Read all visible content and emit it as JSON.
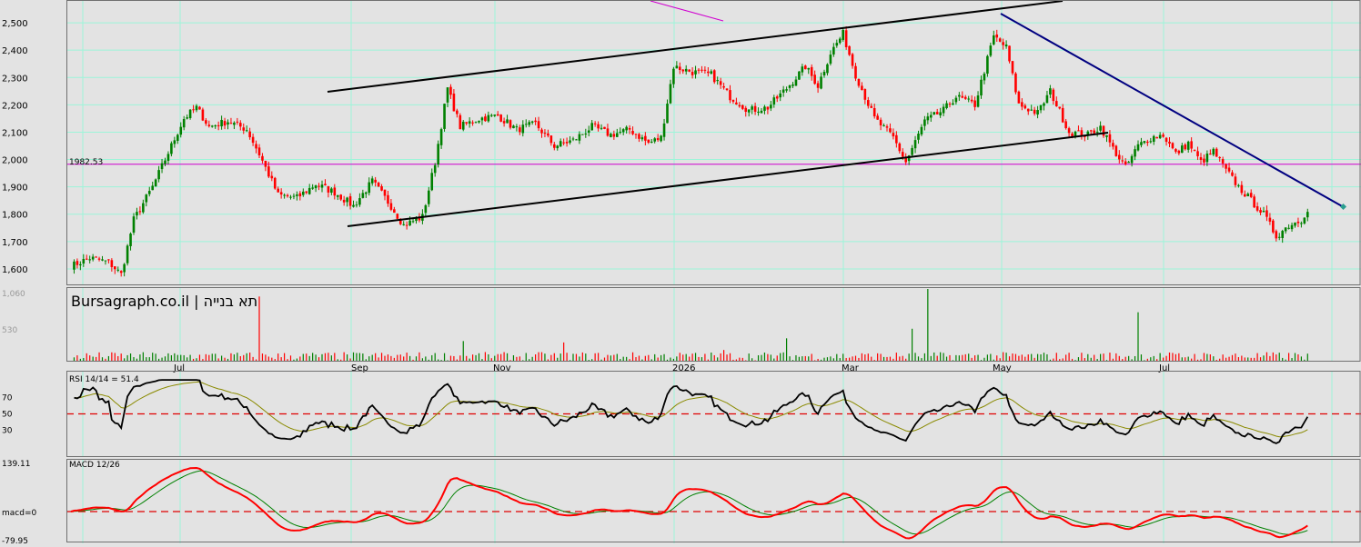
{
  "chart_data": {
    "type": "candlestick",
    "title": "Bursagraph.co.il | תא בנייה",
    "price_axis": {
      "ticks": [
        "2,500",
        "2,400",
        "2,300",
        "2,200",
        "2,100",
        "2,000",
        "1,900",
        "1,800",
        "1,700",
        "1,600"
      ],
      "ylim": [
        1540,
        2570
      ],
      "reference_label": "1982.53",
      "reference_value": 1982.53
    },
    "time_axis": {
      "labels": [
        "Jul",
        "Sep",
        "Nov",
        "2026",
        "Mar",
        "May",
        "Jul"
      ]
    },
    "price_anchors": [
      [
        0,
        1610
      ],
      [
        6,
        1640
      ],
      [
        12,
        1625
      ],
      [
        16,
        1580
      ],
      [
        20,
        1780
      ],
      [
        26,
        1900
      ],
      [
        30,
        2000
      ],
      [
        36,
        2150
      ],
      [
        40,
        2190
      ],
      [
        44,
        2120
      ],
      [
        50,
        2140
      ],
      [
        56,
        2110
      ],
      [
        60,
        2020
      ],
      [
        66,
        1870
      ],
      [
        72,
        1860
      ],
      [
        78,
        1910
      ],
      [
        84,
        1880
      ],
      [
        90,
        1830
      ],
      [
        96,
        1920
      ],
      [
        102,
        1830
      ],
      [
        106,
        1760
      ],
      [
        112,
        1790
      ],
      [
        116,
        1990
      ],
      [
        120,
        2260
      ],
      [
        124,
        2120
      ],
      [
        130,
        2150
      ],
      [
        136,
        2160
      ],
      [
        142,
        2110
      ],
      [
        148,
        2130
      ],
      [
        154,
        2050
      ],
      [
        160,
        2070
      ],
      [
        166,
        2120
      ],
      [
        172,
        2090
      ],
      [
        178,
        2110
      ],
      [
        184,
        2060
      ],
      [
        188,
        2080
      ],
      [
        192,
        2340
      ],
      [
        198,
        2320
      ],
      [
        204,
        2310
      ],
      [
        210,
        2230
      ],
      [
        216,
        2180
      ],
      [
        222,
        2190
      ],
      [
        228,
        2260
      ],
      [
        234,
        2340
      ],
      [
        238,
        2270
      ],
      [
        242,
        2390
      ],
      [
        246,
        2460
      ],
      [
        250,
        2310
      ],
      [
        256,
        2150
      ],
      [
        262,
        2080
      ],
      [
        266,
        1990
      ],
      [
        272,
        2140
      ],
      [
        278,
        2180
      ],
      [
        282,
        2230
      ],
      [
        288,
        2200
      ],
      [
        294,
        2450
      ],
      [
        298,
        2410
      ],
      [
        302,
        2200
      ],
      [
        308,
        2170
      ],
      [
        312,
        2250
      ],
      [
        318,
        2100
      ],
      [
        324,
        2090
      ],
      [
        328,
        2120
      ],
      [
        332,
        2040
      ],
      [
        336,
        1970
      ],
      [
        340,
        2050
      ],
      [
        344,
        2080
      ],
      [
        348,
        2090
      ],
      [
        352,
        2020
      ],
      [
        356,
        2060
      ],
      [
        360,
        1990
      ],
      [
        364,
        2030
      ],
      [
        368,
        1960
      ],
      [
        372,
        1900
      ],
      [
        376,
        1850
      ],
      [
        380,
        1800
      ],
      [
        384,
        1720
      ],
      [
        388,
        1760
      ],
      [
        392,
        1780
      ],
      [
        394,
        1820
      ]
    ],
    "volume_axis": {
      "ticks": [
        "1,060",
        "530"
      ],
      "ylim": [
        0,
        1060
      ]
    },
    "volume_spikes": [
      [
        60,
        950
      ],
      [
        125,
        300
      ],
      [
        157,
        280
      ],
      [
        208,
        170
      ],
      [
        228,
        340
      ],
      [
        268,
        480
      ],
      [
        273,
        1060
      ],
      [
        340,
        720
      ]
    ],
    "rsi": {
      "label": "RSI 14/14 = 51.4",
      "ticks": [
        "70",
        "50",
        "30"
      ],
      "ylim": [
        0,
        100
      ],
      "last": 51.4
    },
    "macd": {
      "label": "MACD 12/26",
      "ticks": [
        "139.11",
        "macd=0",
        "-79.95"
      ],
      "ylim": [
        -79.95,
        139.11
      ]
    },
    "colors": {
      "background": "#e3e3e3",
      "grid": "#9cf5d9",
      "up": "#008000",
      "down": "#ff0000",
      "reference_line": "#d000d0",
      "channel": "#000000",
      "downtrend": "#000080",
      "rsi_line": "#000000",
      "rsi_signal": "#8a8a00",
      "macd_line": "#ff0000",
      "macd_signal": "#008000",
      "dashed_ref": "#e00000"
    }
  }
}
